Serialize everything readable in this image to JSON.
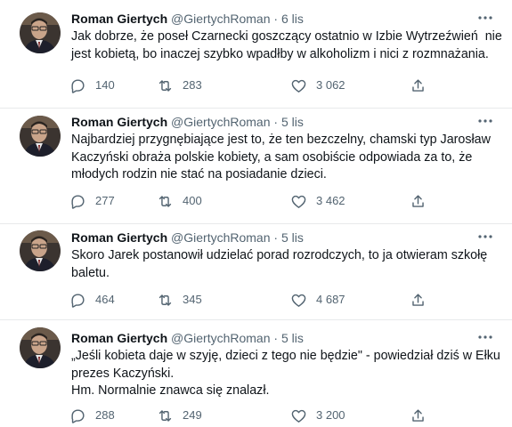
{
  "icons": {
    "more": "more-horizontal-icon",
    "reply": "reply-icon",
    "retweet": "retweet-icon",
    "like": "like-icon",
    "share": "share-icon"
  },
  "colors": {
    "text": "#0f1419",
    "secondary": "#536471",
    "divider": "#e8eaeb"
  },
  "tweets": [
    {
      "name": "Roman Giertych",
      "handle": "@GiertychRoman",
      "separator": "·",
      "time": "6 lis",
      "text_lines": [
        "Jak dobrze, że poseł Czarnecki goszczący ostatnio w Izbie Wytrzeźwień  nie",
        "jest kobietą, bo inaczej szybko wpadłby w alkoholizm i nici z rozmnażania."
      ],
      "replies": "140",
      "retweets": "283",
      "likes": "3 062"
    },
    {
      "name": "Roman Giertych",
      "handle": "@GiertychRoman",
      "separator": "·",
      "time": "5 lis",
      "text_lines": [
        "Najbardziej przygnębiające jest to, że ten bezczelny, chamski typ Jarosław",
        "Kaczyński obraża polskie kobiety, a sam osobiście odpowiada za to, że",
        "młodych rodzin nie stać na posiadanie dzieci."
      ],
      "replies": "277",
      "retweets": "400",
      "likes": "3 462"
    },
    {
      "name": "Roman Giertych",
      "handle": "@GiertychRoman",
      "separator": "·",
      "time": "5 lis",
      "text_lines": [
        "Skoro Jarek postanowił udzielać porad rozrodczych, to ja otwieram szkołę",
        "baletu."
      ],
      "replies": "464",
      "retweets": "345",
      "likes": "4 687"
    },
    {
      "name": "Roman Giertych",
      "handle": "@GiertychRoman",
      "separator": "·",
      "time": "5 lis",
      "text_lines": [
        "„Jeśli kobieta daje w szyję, dzieci z tego nie będzie\" - powiedział dziś w Ełku",
        "prezes Kaczyński.",
        "Hm. Normalnie znawca się znalazł."
      ],
      "replies": "288",
      "retweets": "249",
      "likes": "3 200"
    }
  ]
}
